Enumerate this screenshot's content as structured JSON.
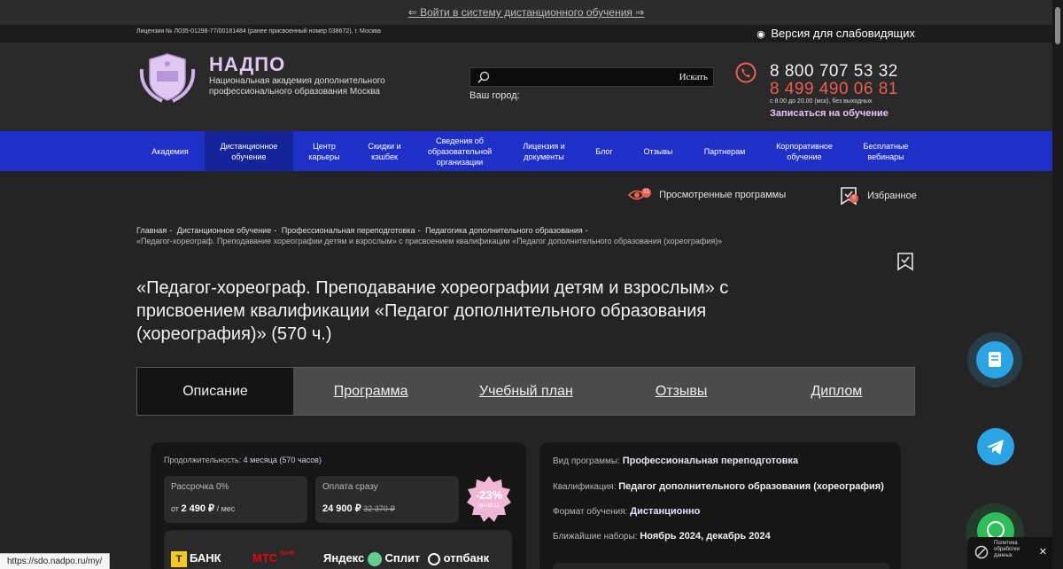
{
  "topbar": {
    "login_link": "⇐ Войти в систему дистанционного обучения ⇒"
  },
  "license_row": {
    "license_text": "Лицензия № Л035-01298-77/00181484 (ранее присвоенный номер 038672), г. Москва",
    "low_vision_label": "Версия для слабовидящих"
  },
  "header": {
    "brand": "НАДПО",
    "brand_sub": "Национальная академия дополнительного профессионального образования Москва",
    "search": {
      "placeholder": "",
      "button_label": "Искать"
    },
    "city_label": "Ваш город:",
    "phone1": "8 800 707 53 32",
    "phone2": "8 499 490 06 81",
    "hours": "с 8.00 до 20.00 (мск), без выходных",
    "enroll_label": "Записаться на обучение"
  },
  "nav": {
    "items": [
      {
        "label": "Академия"
      },
      {
        "label": "Дистанционное обучение",
        "active": true
      },
      {
        "label": "Центр карьеры"
      },
      {
        "label": "Скидки и кэшбек"
      },
      {
        "label": "Сведения об образовательной организации"
      },
      {
        "label": "Лицензия и документы"
      },
      {
        "label": "Блог"
      },
      {
        "label": "Отзывы"
      },
      {
        "label": "Партнерам"
      },
      {
        "label": "Корпоративное обучение"
      },
      {
        "label": "Бесплатные вебинары"
      }
    ]
  },
  "toolbar": {
    "viewed_label": "Просмотренные программы",
    "viewed_count": "31",
    "favorites_label": "Избранное",
    "favorites_count": "0"
  },
  "breadcrumb": {
    "items": [
      "Главная",
      "Дистанционное обучение",
      "Профессиональная переподготовка",
      "Педагогика дополнительного образования"
    ],
    "current": "«Педагог-хореограф. Преподавание хореографии детям и взрослым» с присвоением квалификации «Педагог дополнительного образования (хореография)»"
  },
  "page": {
    "title": "«Педагог-хореограф. Преподавание хореографии детям и взрослым» с присвоением квалификации «Педагог дополнительного образования (хореография)» (570 ч.)"
  },
  "tabs": [
    "Описание",
    "Программа",
    "Учебный план",
    "Отзывы",
    "Диплом"
  ],
  "pricing": {
    "duration_label": "Продолжительность:",
    "duration_value": "4 месяца (570 часов)",
    "installment": {
      "label": "Рассрочка 0%",
      "prefix": "от",
      "value": "2 490 ₽",
      "suffix": "/ мес"
    },
    "full": {
      "label": "Оплата сразу",
      "value": "24 900 ₽",
      "old": "32 370 ₽"
    },
    "discount": {
      "pct": "-23%",
      "until": "до 08.11"
    },
    "banks": [
      "БАНК",
      "МТС",
      "БАНК",
      "Яндекс",
      "Сплит",
      "отпбанк"
    ]
  },
  "program_info": {
    "type_label": "Вид программы:",
    "type_value": "Профессиональная переподготовка",
    "qual_label": "Квалификация:",
    "qual_value": "Педагог дополнительного образования (хореография)",
    "format_label": "Формат обучения:",
    "format_value": "Дистанционно",
    "intake_label": "Ближайшие наборы:",
    "intake_value": "Ноябрь 2024, декабрь 2024"
  },
  "status_url": "https://sdo.nadpo.ru/my/",
  "cookie": {
    "text": "Политика обработки данных"
  },
  "colors": {
    "nav_blue": "#1f30c8",
    "accent_red": "#ec5e4f",
    "lilac": "#e0c8f2",
    "bg": "#242424"
  }
}
